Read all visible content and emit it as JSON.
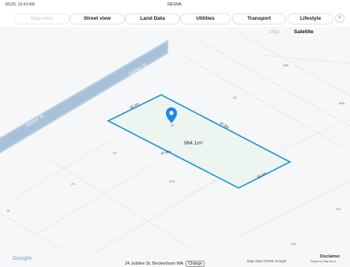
{
  "titlebar": {
    "time": "3/6/25, 10:43 AM",
    "title": "REIWA"
  },
  "tabs": [
    {
      "label": "Map view"
    },
    {
      "label": "Street view"
    },
    {
      "label": "Land Data"
    },
    {
      "label": "Utilities"
    },
    {
      "label": "Transport"
    },
    {
      "label": "Lifestyle"
    }
  ],
  "close_icon_glyph": "✕",
  "map_type": {
    "map": "Map",
    "satellite": "Satellite"
  },
  "streets": [
    {
      "name": "Jubilee St"
    },
    {
      "name": "Jubilee St"
    }
  ],
  "parcel": {
    "area": "964.1m²",
    "sides": [
      "18.1m",
      "47.9m",
      "47.9m",
      "20.1m"
    ],
    "lot_number": "24"
  },
  "lot_numbers": [
    "24B",
    "26",
    "26A",
    "23",
    "29",
    "22A",
    "18",
    "147",
    "145"
  ],
  "footer": {
    "logo": "Google",
    "address": "24 Jubilee St, Beckenham WA",
    "change_label": "Change",
    "disclaimer": "Disclaimer",
    "map_data": "Map data ©2025 Google",
    "report_error": "Report a map error"
  },
  "colors": {
    "parcel_outline": "#1e95d4",
    "pin": "#1e88e5",
    "road": "#a9c1d8",
    "road_border": "#b9cfe0"
  }
}
